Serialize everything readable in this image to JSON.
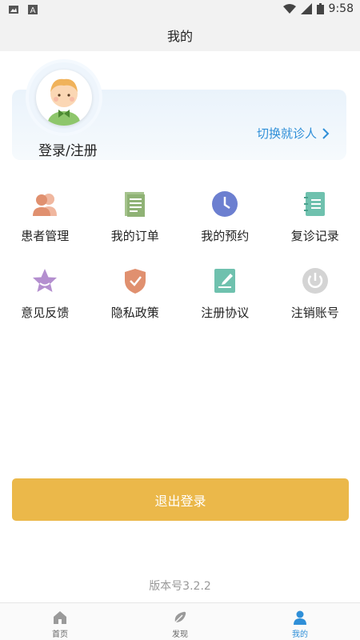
{
  "status_bar": {
    "time": "9:58"
  },
  "header": {
    "title": "我的"
  },
  "profile": {
    "login_label": "登录/注册",
    "switch_label": "切换就诊人"
  },
  "menu": {
    "row1": [
      {
        "label": "患者管理",
        "icon": "patients-icon",
        "color": "#e0906f"
      },
      {
        "label": "我的订单",
        "icon": "orders-icon",
        "color": "#a5c38d"
      },
      {
        "label": "我的预约",
        "icon": "clock-icon",
        "color": "#6c7fd0"
      },
      {
        "label": "复诊记录",
        "icon": "notebook-icon",
        "color": "#6fc1ae"
      }
    ],
    "row2": [
      {
        "label": "意见反馈",
        "icon": "star-icon",
        "color": "#b48fcf"
      },
      {
        "label": "隐私政策",
        "icon": "shield-icon",
        "color": "#e0906f"
      },
      {
        "label": "注册协议",
        "icon": "document-edit-icon",
        "color": "#6fc1ae"
      },
      {
        "label": "注销账号",
        "icon": "power-icon",
        "color": "#cfcfcf"
      }
    ]
  },
  "logout": {
    "label": "退出登录",
    "color": "#ebb84a"
  },
  "version": {
    "text": "版本号3.2.2"
  },
  "tabs": [
    {
      "label": "首页",
      "icon": "home-icon"
    },
    {
      "label": "发现",
      "icon": "discover-icon"
    },
    {
      "label": "我的",
      "icon": "user-icon",
      "active": true
    }
  ]
}
